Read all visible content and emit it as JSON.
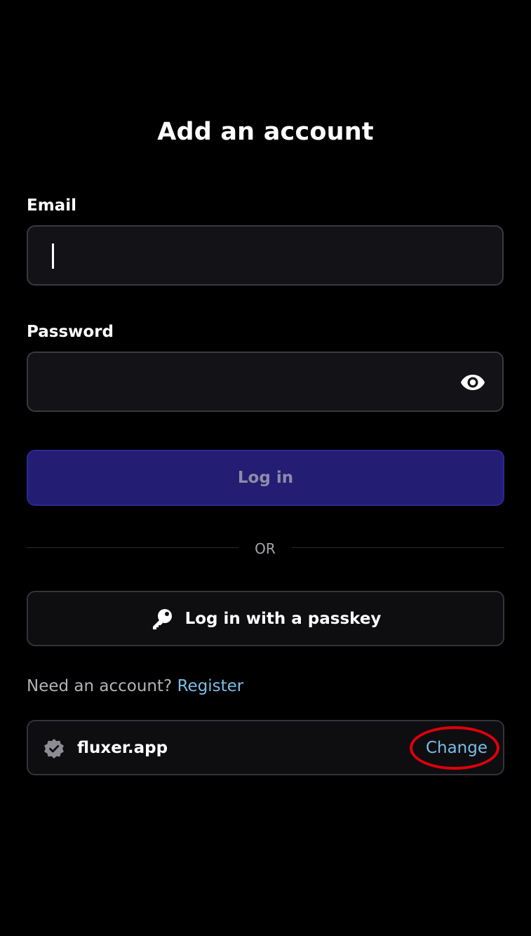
{
  "page": {
    "title": "Add an account"
  },
  "email": {
    "label": "Email",
    "value": "",
    "placeholder": ""
  },
  "password": {
    "label": "Password",
    "value": "",
    "placeholder": "",
    "toggle_icon": "eye-icon"
  },
  "login_button": {
    "label": "Log in"
  },
  "divider": {
    "text": "OR"
  },
  "passkey_button": {
    "label": "Log in with a passkey",
    "icon": "key-icon"
  },
  "register_prompt": {
    "text": "Need an account?",
    "link": "Register"
  },
  "instance": {
    "name": "fluxer.app",
    "icon": "verified-badge-icon",
    "change_label": "Change"
  },
  "colors": {
    "background": "#000000",
    "field_background": "#131217",
    "primary_button": "#231d73",
    "link": "#7bbde6",
    "highlight": "#e0000c"
  }
}
